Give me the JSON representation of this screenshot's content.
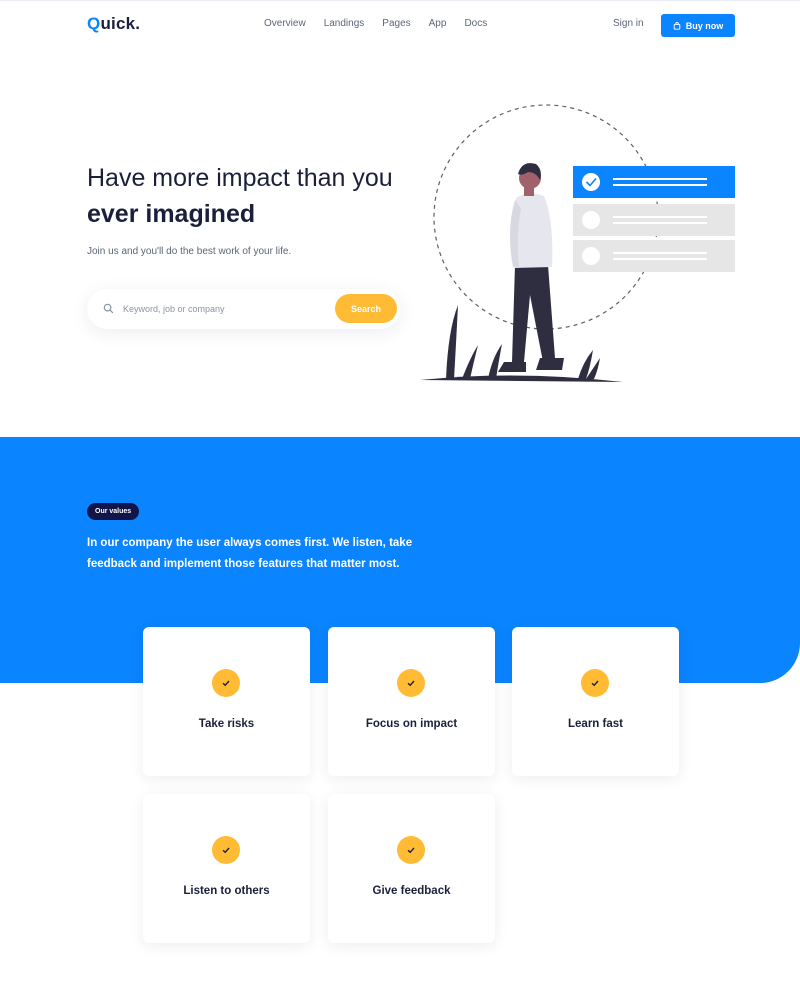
{
  "brand": {
    "logo_q": "Q",
    "logo_rest": "uick."
  },
  "nav": {
    "links": [
      "Overview",
      "Landings",
      "Pages",
      "App",
      "Docs"
    ],
    "signin": "Sign in",
    "buy": "Buy now"
  },
  "hero": {
    "title_line1": "Have more impact than you",
    "title_line2": "ever imagined",
    "subtitle": "Join us and you'll do the best work of your life.",
    "search_placeholder": "Keyword, job or company",
    "search_button": "Search"
  },
  "values": {
    "badge": "Our values",
    "text": "In our company the user always comes first. We listen, take feedback and implement those features that matter most.",
    "cards": [
      "Take risks",
      "Focus on impact",
      "Learn fast",
      "Listen to others",
      "Give feedback"
    ]
  },
  "colors": {
    "primary": "#0a84ff",
    "accent": "#ffbb33",
    "dark": "#12154a"
  }
}
